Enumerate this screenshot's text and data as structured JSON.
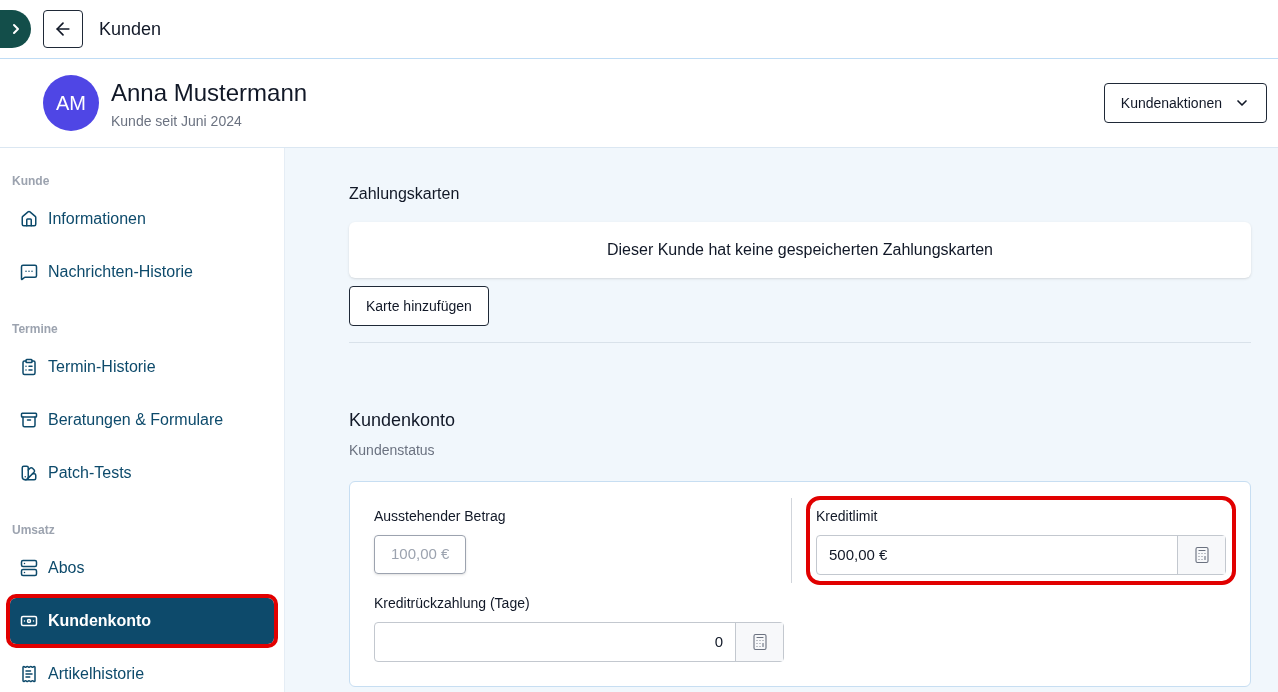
{
  "top_bar": {
    "title": "Kunden"
  },
  "customer": {
    "initials": "AM",
    "name": "Anna Mustermann",
    "subtitle": "Kunde seit Juni 2024",
    "actions_button": "Kundenaktionen"
  },
  "sidebar": {
    "sections": [
      {
        "heading": "Kunde",
        "items": [
          {
            "label": "Informationen",
            "selected": false,
            "highlighted": false
          },
          {
            "label": "Nachrichten-Historie",
            "selected": false,
            "highlighted": false
          }
        ]
      },
      {
        "heading": "Termine",
        "items": [
          {
            "label": "Termin-Historie",
            "selected": false,
            "highlighted": false
          },
          {
            "label": "Beratungen & Formulare",
            "selected": false,
            "highlighted": false
          },
          {
            "label": "Patch-Tests",
            "selected": false,
            "highlighted": false
          }
        ]
      },
      {
        "heading": "Umsatz",
        "items": [
          {
            "label": "Abos",
            "selected": false,
            "highlighted": false
          },
          {
            "label": "Kundenkonto",
            "selected": true,
            "highlighted": true
          },
          {
            "label": "Artikelhistorie",
            "selected": false,
            "highlighted": false
          }
        ]
      }
    ]
  },
  "payment_cards": {
    "title": "Zahlungskarten",
    "empty_message": "Dieser Kunde hat keine gespeicherten Zahlungskarten",
    "add_button": "Karte hinzufügen"
  },
  "customer_account": {
    "title": "Kundenkonto",
    "subtitle": "Kundenstatus",
    "fields": [
      {
        "kind": "readonly",
        "label": "Ausstehender Betrag",
        "value": "100,00 €",
        "disabled": true,
        "highlighted": false
      },
      {
        "kind": "currency",
        "label": "Kreditlimit",
        "value": "500,00 €",
        "highlighted": true
      },
      {
        "kind": "count",
        "label": "Kreditrückzahlung (Tage)",
        "value": "0",
        "highlighted": false
      }
    ]
  }
}
